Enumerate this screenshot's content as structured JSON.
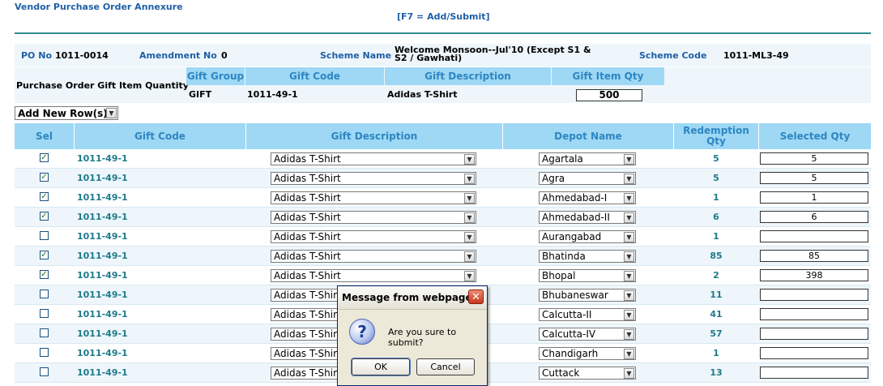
{
  "page": {
    "title": "Vendor Purchase Order  Annexure",
    "shortcut_hint": "[F7 = Add/Submit]"
  },
  "po_info": {
    "po_no_label": "PO No",
    "po_no_value": "1011-0014",
    "amendment_label": "Amendment No",
    "amendment_value": "0",
    "scheme_name_label": "Scheme Name",
    "scheme_name_line1": "Welcome Monsoon--Jul'10 (Except S1 &",
    "scheme_name_line2": "S2 / Gawhati)",
    "scheme_code_label": "Scheme Code",
    "scheme_code_value": "1011-ML3-49"
  },
  "gift_summary": {
    "section_label": "Purchase Order Gift Item Quantity",
    "headers": [
      "Gift Group",
      "Gift Code",
      "Gift Description",
      "Gift Item Qty"
    ],
    "row": {
      "group": "GIFT",
      "code": "1011-49-1",
      "description": "Adidas T-Shirt",
      "qty": "500"
    }
  },
  "add_row_select": {
    "value": "Add New Row(s)"
  },
  "table": {
    "headers": {
      "sel": "Sel",
      "gift_code": "Gift Code",
      "gift_description": "Gift Description",
      "depot_name": "Depot Name",
      "redemption_line1": "Redemption",
      "redemption_line2": "Qty",
      "selected_qty": "Selected Qty"
    },
    "rows": [
      {
        "checked": true,
        "gift_code": "1011-49-1",
        "description": "Adidas T-Shirt",
        "depot": "Agartala",
        "redemption": "5",
        "selected_qty": "5"
      },
      {
        "checked": true,
        "gift_code": "1011-49-1",
        "description": "Adidas T-Shirt",
        "depot": "Agra",
        "redemption": "5",
        "selected_qty": "5"
      },
      {
        "checked": true,
        "gift_code": "1011-49-1",
        "description": "Adidas T-Shirt",
        "depot": "Ahmedabad-I",
        "redemption": "1",
        "selected_qty": "1"
      },
      {
        "checked": true,
        "gift_code": "1011-49-1",
        "description": "Adidas T-Shirt",
        "depot": "Ahmedabad-II",
        "redemption": "6",
        "selected_qty": "6"
      },
      {
        "checked": false,
        "gift_code": "1011-49-1",
        "description": "Adidas T-Shirt",
        "depot": "Aurangabad",
        "redemption": "1",
        "selected_qty": ""
      },
      {
        "checked": true,
        "gift_code": "1011-49-1",
        "description": "Adidas T-Shirt",
        "depot": "Bhatinda",
        "redemption": "85",
        "selected_qty": "85"
      },
      {
        "checked": true,
        "gift_code": "1011-49-1",
        "description": "Adidas T-Shirt",
        "depot": "Bhopal",
        "redemption": "2",
        "selected_qty": "398"
      },
      {
        "checked": false,
        "gift_code": "1011-49-1",
        "description": "Adidas T-Shir",
        "depot": "Bhubaneswar",
        "redemption": "11",
        "selected_qty": ""
      },
      {
        "checked": false,
        "gift_code": "1011-49-1",
        "description": "Adidas T-Shir",
        "depot": "Calcutta-II",
        "redemption": "41",
        "selected_qty": ""
      },
      {
        "checked": false,
        "gift_code": "1011-49-1",
        "description": "Adidas T-Shir",
        "depot": "Calcutta-IV",
        "redemption": "57",
        "selected_qty": ""
      },
      {
        "checked": false,
        "gift_code": "1011-49-1",
        "description": "Adidas T-Shir",
        "depot": "Chandigarh",
        "redemption": "1",
        "selected_qty": ""
      },
      {
        "checked": false,
        "gift_code": "1011-49-1",
        "description": "Adidas T-Shir",
        "depot": "Cuttack",
        "redemption": "13",
        "selected_qty": ""
      }
    ]
  },
  "dialog": {
    "title": "Message from webpage",
    "close_glyph": "✕",
    "icon": "question-icon",
    "icon_glyph": "?",
    "message": "Are you sure to submit?",
    "ok_label": "OK",
    "cancel_label": "Cancel"
  },
  "colors": {
    "header_bg": "#9ed8f5",
    "header_text": "#2e86c1",
    "label_blue": "#1f5fa5",
    "code_teal": "#1f7a8a"
  }
}
